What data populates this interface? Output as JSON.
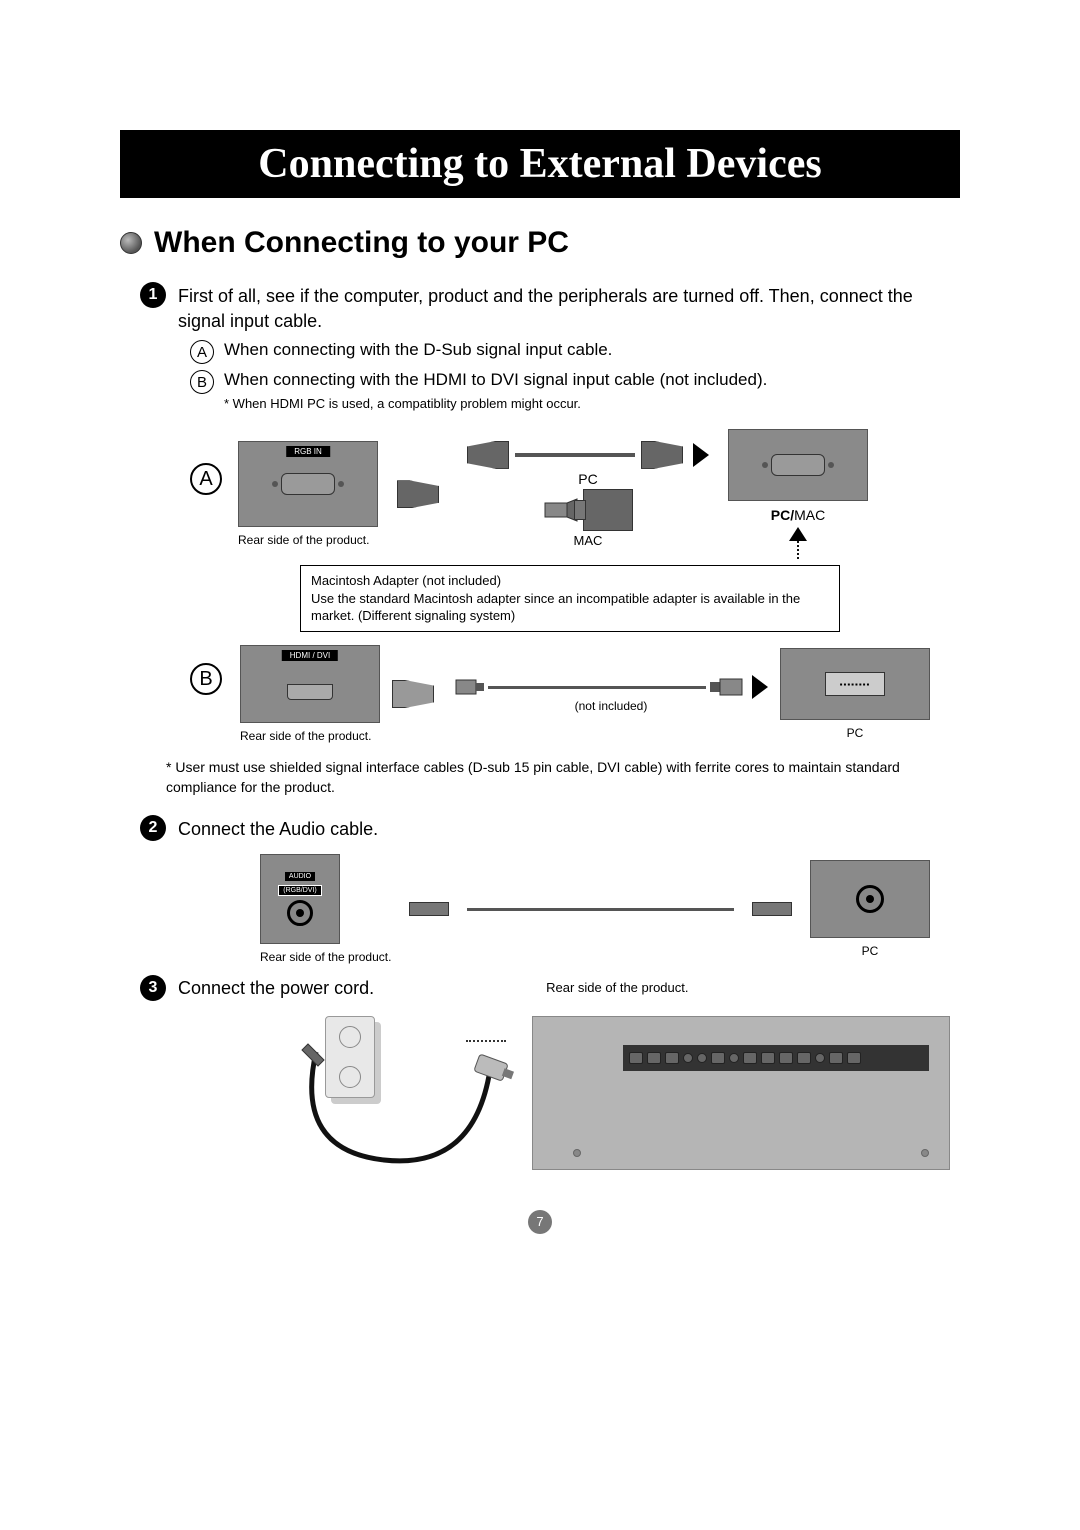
{
  "title": "Connecting to External Devices",
  "section": "When Connecting to your PC",
  "step1": {
    "num": "1",
    "text": "First of all, see if the computer, product and the peripherals are turned off. Then, connect the signal input cable.",
    "A": "When connecting with the D-Sub signal input cable.",
    "B": "When connecting with the HDMI to DVI signal input cable (not included).",
    "hdmi_note": "* When HDMI PC is used, a compatiblity problem might occur."
  },
  "diagA": {
    "letter": "A",
    "port_label": "RGB IN",
    "rear_caption": "Rear side of the product.",
    "pc": "PC",
    "mac": "MAC",
    "pcmac_pc": "PC/",
    "pcmac_mac": "MAC",
    "mac_adapter_title": "Macintosh Adapter (not included)",
    "mac_adapter_body": "Use the standard Macintosh adapter since an incompatible adapter is available in the market. (Different signaling system)"
  },
  "diagB": {
    "letter": "B",
    "port_label": "HDMI / DVI",
    "rear_caption": "Rear side of the product.",
    "not_included": "(not included)",
    "pc": "PC"
  },
  "shield_note": "* User must use shielded signal interface cables (D-sub 15 pin cable, DVI cable) with ferrite cores to maintain standard compliance for the product.",
  "step2": {
    "num": "2",
    "text": "Connect the Audio cable.",
    "port_label_top": "AUDIO",
    "port_label_bottom": "(RGB/DVI)",
    "rear_caption": "Rear side of the product.",
    "pc": "PC"
  },
  "step3": {
    "num": "3",
    "text": "Connect the power cord.",
    "rear_caption": "Rear side of the product."
  },
  "page_number": "7"
}
